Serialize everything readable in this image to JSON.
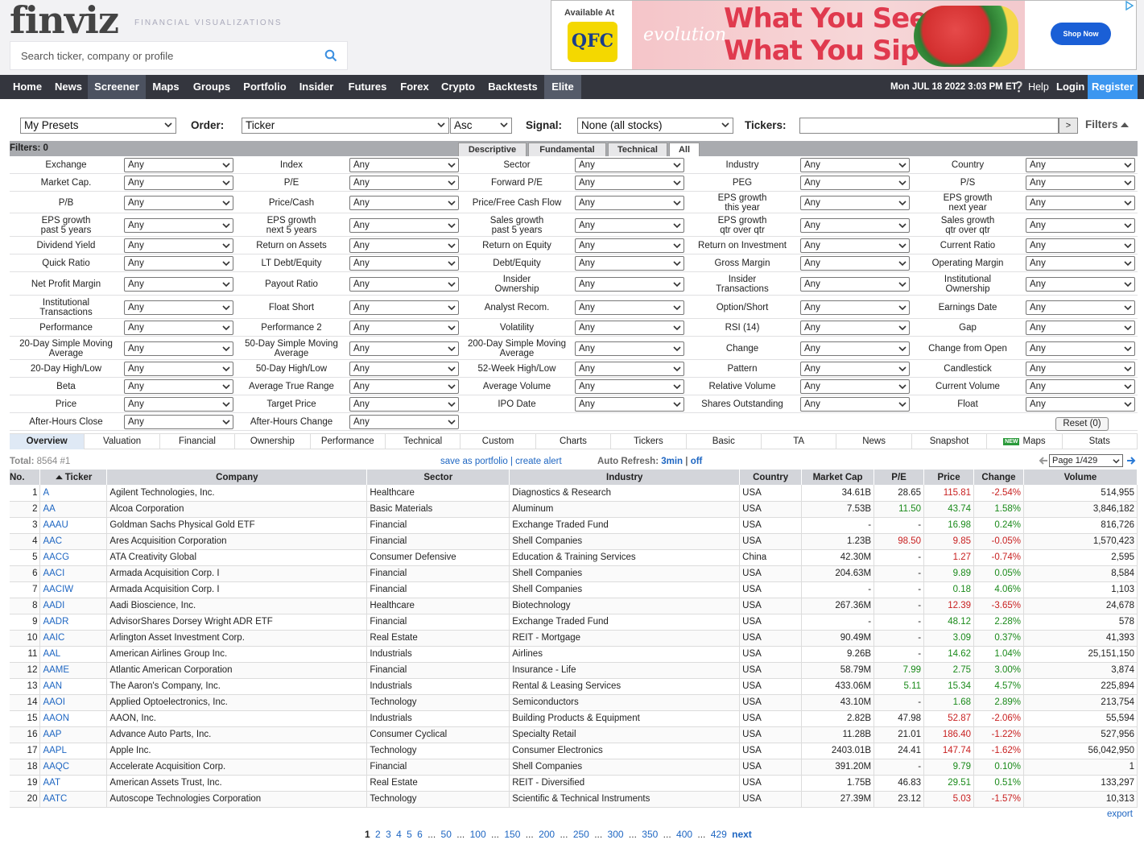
{
  "header": {
    "logo": "finviz",
    "tagline": "FINANCIAL VISUALIZATIONS",
    "search_placeholder": "Search ticker, company or profile"
  },
  "ad": {
    "available_at": "Available At",
    "store_logo": "QFC",
    "brand": "evolution",
    "headline_1": "What You See Is",
    "headline_2": "What You Sip",
    "cta": "Shop Now"
  },
  "nav": {
    "items": [
      "Home",
      "News",
      "Screener",
      "Maps",
      "Groups",
      "Portfolio",
      "Insider",
      "Futures",
      "Forex",
      "Crypto",
      "Backtests",
      "Elite"
    ],
    "selected": "Screener",
    "date": "Mon JUL 18 2022 3:03 PM ET",
    "help": "Help",
    "login": "Login",
    "register": "Register"
  },
  "controls": {
    "presets": "My Presets",
    "order_label": "Order:",
    "order_value": "Ticker",
    "order_dir": "Asc",
    "signal_label": "Signal:",
    "signal_value": "None (all stocks)",
    "tickers_label": "Tickers:",
    "go": ">",
    "filters_toggle": "Filters"
  },
  "filters": {
    "count_label": "Filters: 0",
    "tabs": [
      "Descriptive",
      "Fundamental",
      "Technical",
      "All"
    ],
    "active_tab": "All",
    "rows": [
      [
        "Exchange",
        "Index",
        "Sector",
        "Industry",
        "Country"
      ],
      [
        "Market Cap.",
        "P/E",
        "Forward P/E",
        "PEG",
        "P/S"
      ],
      [
        "P/B",
        "Price/Cash",
        "Price/Free Cash Flow",
        "EPS growth\nthis year",
        "EPS growth\nnext year"
      ],
      [
        "EPS growth\npast 5 years",
        "EPS growth\nnext 5 years",
        "Sales growth\npast 5 years",
        "EPS growth\nqtr over qtr",
        "Sales growth\nqtr over qtr"
      ],
      [
        "Dividend Yield",
        "Return on Assets",
        "Return on Equity",
        "Return on Investment",
        "Current Ratio"
      ],
      [
        "Quick Ratio",
        "LT Debt/Equity",
        "Debt/Equity",
        "Gross Margin",
        "Operating Margin"
      ],
      [
        "Net Profit Margin",
        "Payout Ratio",
        "Insider\nOwnership",
        "Insider\nTransactions",
        "Institutional\nOwnership"
      ],
      [
        "Institutional\nTransactions",
        "Float Short",
        "Analyst Recom.",
        "Option/Short",
        "Earnings Date"
      ],
      [
        "Performance",
        "Performance 2",
        "Volatility",
        "RSI (14)",
        "Gap"
      ],
      [
        "20-Day Simple Moving\nAverage",
        "50-Day Simple Moving\nAverage",
        "200-Day Simple Moving\nAverage",
        "Change",
        "Change from Open"
      ],
      [
        "20-Day High/Low",
        "50-Day High/Low",
        "52-Week High/Low",
        "Pattern",
        "Candlestick"
      ],
      [
        "Beta",
        "Average True Range",
        "Average Volume",
        "Relative Volume",
        "Current Volume"
      ],
      [
        "Price",
        "Target Price",
        "IPO Date",
        "Shares Outstanding",
        "Float"
      ],
      [
        "After-Hours Close",
        "After-Hours Change",
        "",
        "",
        ""
      ]
    ],
    "default_value": "Any",
    "reset": "Reset (0)"
  },
  "view_tabs": [
    "Overview",
    "Valuation",
    "Financial",
    "Ownership",
    "Performance",
    "Technical",
    "Custom",
    "Charts",
    "Tickers",
    "Basic",
    "TA",
    "News",
    "Snapshot",
    "Maps",
    "Stats"
  ],
  "view_tab_active": "Overview",
  "new_badge": "NEW",
  "summary": {
    "total_label": "Total:",
    "total": "8564",
    "position": "#1",
    "save_as_portfolio": "save as portfolio",
    "create_alert": "create alert",
    "auto_refresh_label": "Auto Refresh:",
    "auto_refresh_interval": "3min",
    "auto_refresh_off": "off",
    "page_select": "Page 1/429"
  },
  "table": {
    "headers": [
      "No.",
      "Ticker",
      "Company",
      "Sector",
      "Industry",
      "Country",
      "Market Cap",
      "P/E",
      "Price",
      "Change",
      "Volume"
    ],
    "rows": [
      [
        "1",
        "A",
        "Agilent Technologies, Inc.",
        "Healthcare",
        "Diagnostics & Research",
        "USA",
        "34.61B",
        "28.65",
        "115.81",
        "-2.54%",
        "514,955"
      ],
      [
        "2",
        "AA",
        "Alcoa Corporation",
        "Basic Materials",
        "Aluminum",
        "USA",
        "7.53B",
        "11.50",
        "43.74",
        "1.58%",
        "3,846,182"
      ],
      [
        "3",
        "AAAU",
        "Goldman Sachs Physical Gold ETF",
        "Financial",
        "Exchange Traded Fund",
        "USA",
        "-",
        "-",
        "16.98",
        "0.24%",
        "816,726"
      ],
      [
        "4",
        "AAC",
        "Ares Acquisition Corporation",
        "Financial",
        "Shell Companies",
        "USA",
        "1.23B",
        "98.50",
        "9.85",
        "-0.05%",
        "1,570,423"
      ],
      [
        "5",
        "AACG",
        "ATA Creativity Global",
        "Consumer Defensive",
        "Education & Training Services",
        "China",
        "42.30M",
        "-",
        "1.27",
        "-0.74%",
        "2,595"
      ],
      [
        "6",
        "AACI",
        "Armada Acquisition Corp. I",
        "Financial",
        "Shell Companies",
        "USA",
        "204.63M",
        "-",
        "9.89",
        "0.05%",
        "8,584"
      ],
      [
        "7",
        "AACIW",
        "Armada Acquisition Corp. I",
        "Financial",
        "Shell Companies",
        "USA",
        "-",
        "-",
        "0.18",
        "4.06%",
        "1,103"
      ],
      [
        "8",
        "AADI",
        "Aadi Bioscience, Inc.",
        "Healthcare",
        "Biotechnology",
        "USA",
        "267.36M",
        "-",
        "12.39",
        "-3.65%",
        "24,678"
      ],
      [
        "9",
        "AADR",
        "AdvisorShares Dorsey Wright ADR ETF",
        "Financial",
        "Exchange Traded Fund",
        "USA",
        "-",
        "-",
        "48.12",
        "2.28%",
        "578"
      ],
      [
        "10",
        "AAIC",
        "Arlington Asset Investment Corp.",
        "Real Estate",
        "REIT - Mortgage",
        "USA",
        "90.49M",
        "-",
        "3.09",
        "0.37%",
        "41,393"
      ],
      [
        "11",
        "AAL",
        "American Airlines Group Inc.",
        "Industrials",
        "Airlines",
        "USA",
        "9.26B",
        "-",
        "14.62",
        "1.04%",
        "25,151,150"
      ],
      [
        "12",
        "AAME",
        "Atlantic American Corporation",
        "Financial",
        "Insurance - Life",
        "USA",
        "58.79M",
        "7.99",
        "2.75",
        "3.00%",
        "3,874"
      ],
      [
        "13",
        "AAN",
        "The Aaron's Company, Inc.",
        "Industrials",
        "Rental & Leasing Services",
        "USA",
        "433.06M",
        "5.11",
        "15.34",
        "4.57%",
        "225,894"
      ],
      [
        "14",
        "AAOI",
        "Applied Optoelectronics, Inc.",
        "Technology",
        "Semiconductors",
        "USA",
        "43.10M",
        "-",
        "1.68",
        "2.89%",
        "213,754"
      ],
      [
        "15",
        "AAON",
        "AAON, Inc.",
        "Industrials",
        "Building Products & Equipment",
        "USA",
        "2.82B",
        "47.98",
        "52.87",
        "-2.06%",
        "55,594"
      ],
      [
        "16",
        "AAP",
        "Advance Auto Parts, Inc.",
        "Consumer Cyclical",
        "Specialty Retail",
        "USA",
        "11.28B",
        "21.01",
        "186.40",
        "-1.22%",
        "527,956"
      ],
      [
        "17",
        "AAPL",
        "Apple Inc.",
        "Technology",
        "Consumer Electronics",
        "USA",
        "2403.01B",
        "24.41",
        "147.74",
        "-1.62%",
        "56,042,950"
      ],
      [
        "18",
        "AAQC",
        "Accelerate Acquisition Corp.",
        "Financial",
        "Shell Companies",
        "USA",
        "391.20M",
        "-",
        "9.79",
        "0.10%",
        "1"
      ],
      [
        "19",
        "AAT",
        "American Assets Trust, Inc.",
        "Real Estate",
        "REIT - Diversified",
        "USA",
        "1.75B",
        "46.83",
        "29.51",
        "0.51%",
        "133,297"
      ],
      [
        "20",
        "AATC",
        "Autoscope Technologies Corporation",
        "Technology",
        "Scientific & Technical Instruments",
        "USA",
        "27.39M",
        "23.12",
        "5.03",
        "-1.57%",
        "10,313"
      ]
    ]
  },
  "colors": {
    "up": "#1a8a1a",
    "down": "#c81f1f",
    "link": "#1e66c2",
    "nav_bg": "#34363e",
    "register_bg": "#3b96f0"
  },
  "export": "export",
  "pagination": {
    "items": [
      "1",
      "2",
      "3",
      "4",
      "5",
      "6",
      "...",
      "50",
      "...",
      "100",
      "...",
      "150",
      "...",
      "200",
      "...",
      "250",
      "...",
      "300",
      "...",
      "350",
      "...",
      "400",
      "...",
      "429"
    ],
    "current": "1",
    "next": "next"
  }
}
